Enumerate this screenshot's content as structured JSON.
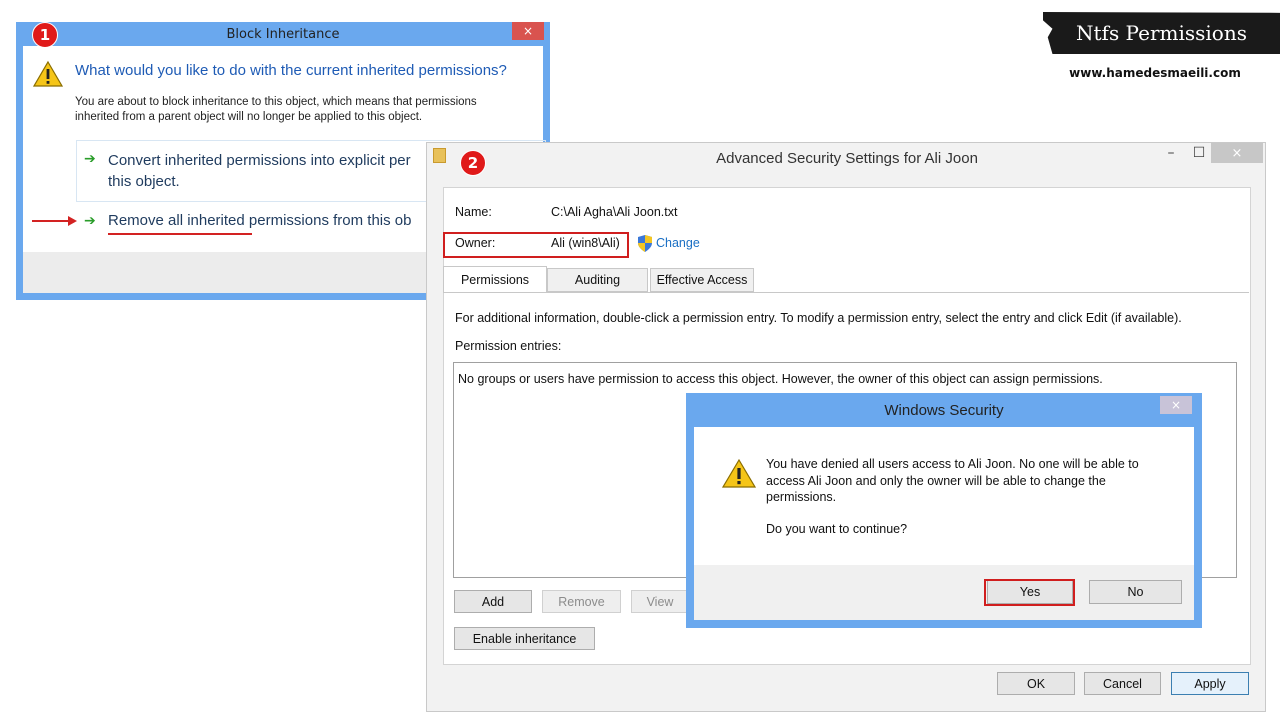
{
  "banner": {
    "title": "Ntfs Permissions",
    "website": "www.hamedesmaeili.com"
  },
  "dialog1": {
    "step": "1",
    "title": "Block Inheritance",
    "close": "×",
    "question": "What would you like to do with the current inherited permissions?",
    "description_line1": "You are about to block inheritance to this object, which means that permissions",
    "description_line2": "inherited from a parent object will no longer be applied to this object.",
    "option1_line1": "Convert inherited permissions into explicit per",
    "option1_line2": "this object.",
    "option2_underlined": "Remove all inherited",
    "option2_rest": " permissions from this ob"
  },
  "dialog2": {
    "step": "2",
    "title": "Advanced Security Settings for Ali Joon",
    "minimize": "–",
    "maximize": "☐",
    "close": "×",
    "name_label": "Name:",
    "name_value": "C:\\Ali Agha\\Ali Joon.txt",
    "owner_label": "Owner:",
    "owner_value": "Ali (win8\\Ali)",
    "change_link": "Change",
    "tabs": [
      "Permissions",
      "Auditing",
      "Effective Access"
    ],
    "info_text": "For additional information, double-click a permission entry. To modify a permission entry, select the entry and click Edit (if available).",
    "entries_label": "Permission entries:",
    "entries_text": "No groups or users have permission to access this object. However, the owner of this object can assign permissions.",
    "add": "Add",
    "remove": "Remove",
    "view": "View",
    "enable_inheritance": "Enable inheritance",
    "ok": "OK",
    "cancel": "Cancel",
    "apply": "Apply"
  },
  "dialog3": {
    "title": "Windows Security",
    "close": "×",
    "message_line1": "You have denied all users access to Ali Joon. No one will be able to",
    "message_line2": "access Ali Joon and only the owner will be able to change the",
    "message_line3": "permissions.",
    "question": "Do you want to continue?",
    "yes": "Yes",
    "no": "No"
  }
}
